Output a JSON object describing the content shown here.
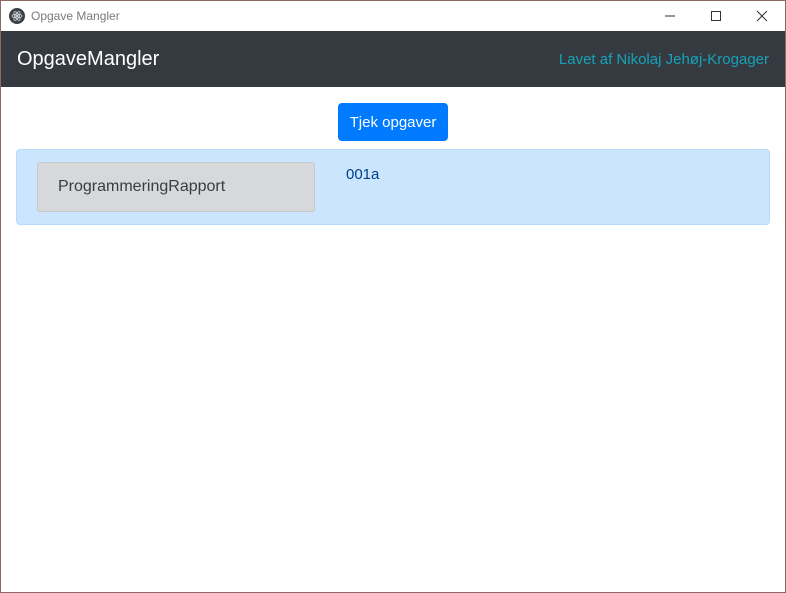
{
  "window": {
    "title": "Opgave Mangler",
    "controls": [
      "minimize-icon",
      "maximize-icon",
      "close-icon"
    ]
  },
  "navbar": {
    "brand": "OpgaveMangler",
    "credit": "Lavet af Nikolaj Jehøj-Krogager"
  },
  "main": {
    "check_button_label": "Tjek opgaver",
    "results": [
      {
        "subject": "ProgrammeringRapport",
        "tasks": [
          "001a"
        ]
      }
    ]
  },
  "colors": {
    "navbar_bg": "#343a40",
    "credit_text": "#17a2b8",
    "primary_button": "#007bff",
    "alert_bg": "#cce5ff",
    "alert_text": "#004085",
    "subject_button_bg": "#d6d8db"
  }
}
